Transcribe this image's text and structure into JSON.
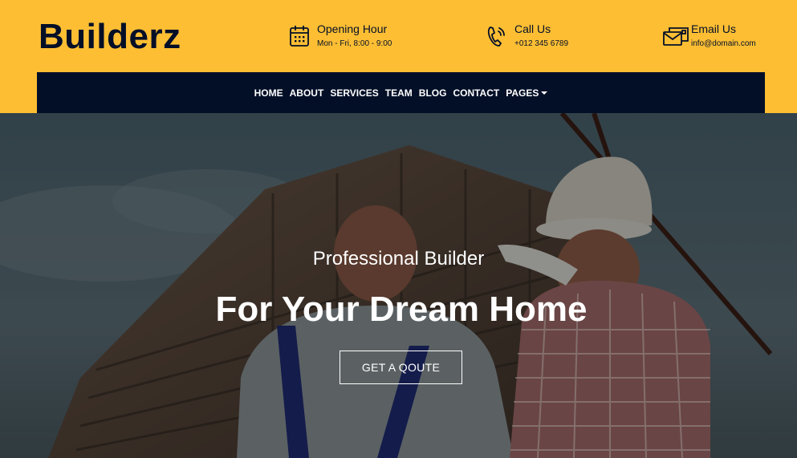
{
  "brand": {
    "name": "Builderz"
  },
  "contact": {
    "hours": {
      "title": "Opening Hour",
      "value": "Mon - Fri, 8:00 - 9:00",
      "icon": "calendar-icon"
    },
    "call": {
      "title": "Call Us",
      "value": "+012 345 6789",
      "icon": "phone-icon"
    },
    "email": {
      "title": "Email Us",
      "value": "info@domain.com",
      "icon": "envelope-icon"
    }
  },
  "nav": {
    "items": [
      {
        "label": "HOME"
      },
      {
        "label": "ABOUT"
      },
      {
        "label": "SERVICES"
      },
      {
        "label": "TEAM"
      },
      {
        "label": "BLOG"
      },
      {
        "label": "CONTACT"
      },
      {
        "label": "PAGES"
      }
    ]
  },
  "hero": {
    "subtitle": "Professional Builder",
    "title": "For Your Dream Home",
    "cta": "GET A QOUTE"
  },
  "colors": {
    "accent": "#fdbe33",
    "dark": "#030f27",
    "white": "#ffffff"
  }
}
